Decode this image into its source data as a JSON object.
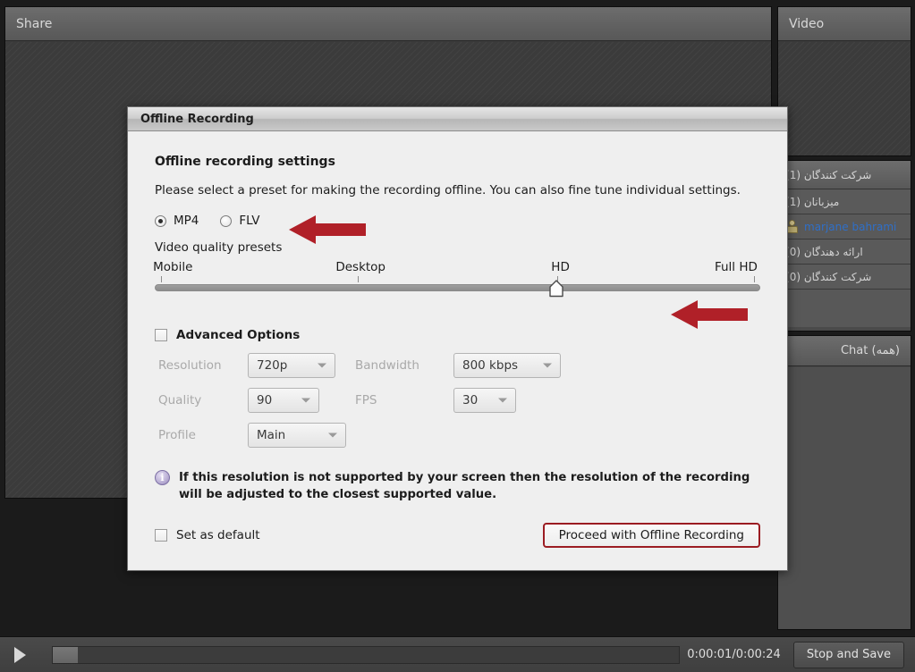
{
  "colors": {
    "accent_red": "#b02028",
    "button_border_red": "#9b1c22",
    "panel_bg": "#3b3b3b",
    "dialog_bg": "#efefef",
    "link_blue": "#2f6fc8",
    "info_icon": "#8f81b5"
  },
  "share_pod": {
    "title": "Share"
  },
  "video_pod": {
    "title": "Video"
  },
  "attendees_pod": {
    "header": "شرکت کنندگان  (1)",
    "rows": [
      {
        "label": "میزبانان (1)",
        "type": "group"
      },
      {
        "label": "marjane bahrami",
        "type": "user",
        "icon": "person-icon"
      },
      {
        "label": "ارائه دهندگان (0)",
        "type": "group"
      },
      {
        "label": "شرکت کنندگان (0)",
        "type": "group"
      }
    ]
  },
  "chat_pod": {
    "title": "Chat (همه)"
  },
  "bottom_bar": {
    "play_icon": "play-icon",
    "time": "0:00:01/0:00:24",
    "progress_percent": 4,
    "stop_save_label": "Stop and Save"
  },
  "dialog": {
    "title": "Offline Recording",
    "heading": "Offline recording settings",
    "description": "Please select a preset for making the recording offline. You can also fine tune individual settings.",
    "format": {
      "selected": "MP4",
      "options": [
        {
          "label": "MP4",
          "selected": true
        },
        {
          "label": "FLV",
          "selected": false
        }
      ]
    },
    "presets": {
      "label": "Video quality presets",
      "ticks": [
        "Mobile",
        "Desktop",
        "HD",
        "Full HD"
      ],
      "selected_index": 2,
      "selected_value": "HD"
    },
    "advanced": {
      "checkbox_label": "Advanced Options",
      "checked": false,
      "fields": [
        {
          "label": "Resolution",
          "value": "720p"
        },
        {
          "label": "Bandwidth",
          "value": "800 kbps"
        },
        {
          "label": "Quality",
          "value": "90"
        },
        {
          "label": "FPS",
          "value": "30"
        },
        {
          "label": "Profile",
          "value": "Main"
        }
      ]
    },
    "note": {
      "icon": "info-icon",
      "glyph": "i",
      "text": "If this resolution is not supported by your screen then the resolution of the recording will be adjusted to the closest supported value."
    },
    "set_default": {
      "label": "Set as default",
      "checked": false
    },
    "proceed_label": "Proceed with Offline Recording"
  },
  "annotations": [
    {
      "name": "arrow-format-row",
      "direction": "left"
    },
    {
      "name": "arrow-slider-row",
      "direction": "left"
    }
  ]
}
